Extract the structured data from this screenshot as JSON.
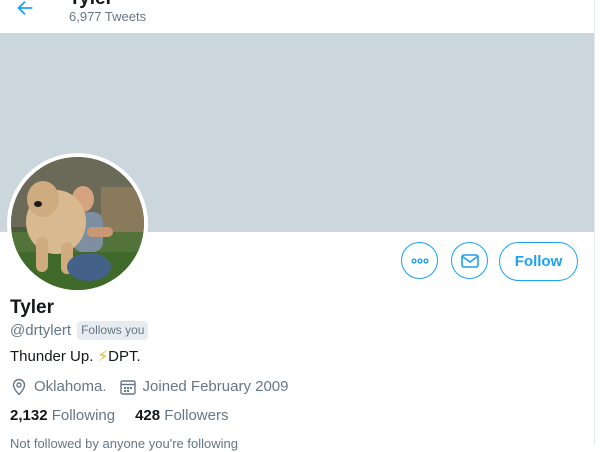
{
  "header": {
    "title": "Tyler",
    "tweet_count": "6,977 Tweets",
    "back_icon": "arrow-left-icon"
  },
  "profile": {
    "name": "Tyler",
    "handle": "@drtylert",
    "follows_you": "Follows you",
    "bio_before": "Thunder Up.",
    "bio_emoji": "⚡",
    "bio_after": "DPT.",
    "location": "Oklahoma.",
    "joined": "Joined February 2009",
    "following_count": "2,132",
    "following_label": "Following",
    "followers_count": "428",
    "followers_label": "Followers",
    "not_followed": "Not followed by anyone you're following"
  },
  "actions": {
    "follow_label": "Follow",
    "more_icon": "more-icon",
    "message_icon": "mail-icon"
  },
  "colors": {
    "accent": "#1da1f2",
    "banner": "#ccd6dd",
    "secondary_text": "#657786"
  }
}
